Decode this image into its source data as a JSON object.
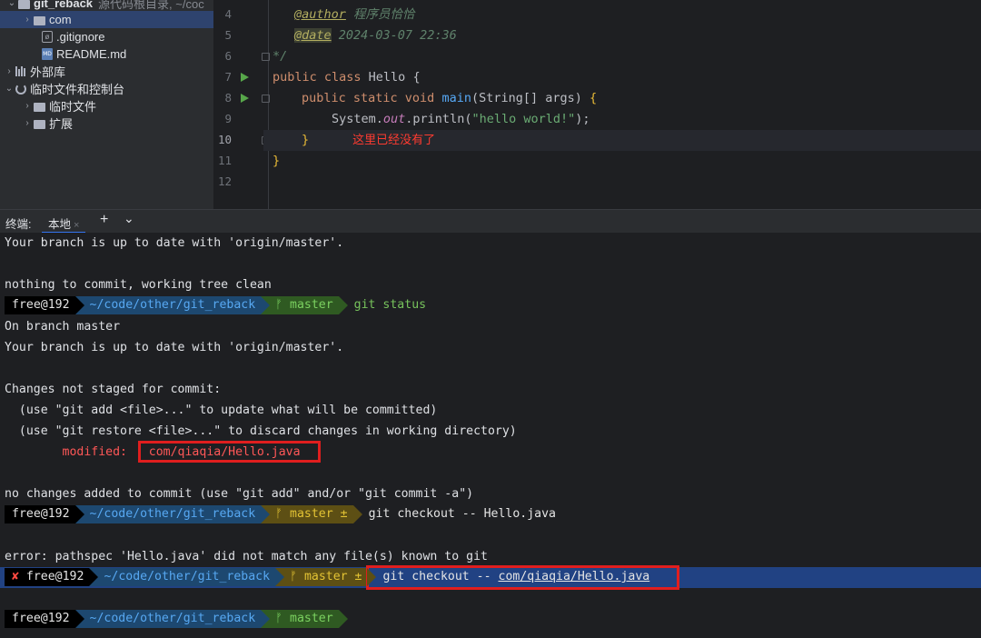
{
  "project_tree": {
    "root": {
      "name": "git_reback",
      "hint": "源代码根目录, ~/coc"
    },
    "items": [
      {
        "label": "com"
      },
      {
        "label": ".gitignore"
      },
      {
        "label": "README.md"
      },
      {
        "label": "外部库"
      },
      {
        "label": "临时文件和控制台"
      },
      {
        "label": "临时文件"
      },
      {
        "label": "扩展"
      }
    ]
  },
  "editor": {
    "line_numbers": [
      "4",
      "5",
      "6",
      "7",
      "8",
      "9",
      "10",
      "11",
      "12"
    ],
    "code": {
      "l4_tag": "@author",
      "l4_text": " 程序员恰恰",
      "l5_tag": "@date",
      "l5_text": " 2024-03-07 22:36",
      "l6": "*/",
      "l7_kw": "public class ",
      "l7_name": "Hello ",
      "l7_brace": "{",
      "l8_kw": "public static void ",
      "l8_fn": "main",
      "l8_args": "(String[] args) ",
      "l8_brace": "{",
      "l9_a": "System.",
      "l9_field": "out",
      "l9_b": ".println(",
      "l9_str": "\"hello world!\"",
      "l9_c": ");",
      "l10_brace": "}",
      "l10_note": "这里已经没有了",
      "l11": "}"
    }
  },
  "terminal_tabs": {
    "label": "终端:",
    "local_tab": "本地",
    "close": "×",
    "add": "+",
    "dropdown": "⌄"
  },
  "terminal": {
    "lines": {
      "l1": "Your branch is up to date with 'origin/master'.",
      "l2": "nothing to commit, working tree clean",
      "l4": "On branch master",
      "l5": "Your branch is up to date with 'origin/master'.",
      "l6": "Changes not staged for commit:",
      "l7": "  (use \"git add <file>...\" to update what will be committed)",
      "l8": "  (use \"git restore <file>...\" to discard changes in working directory)",
      "l9_label": "        modified:   ",
      "l9_file": "com/qiaqia/Hello.java",
      "l10": "no changes added to commit (use \"git add\" and/or \"git commit -a\")",
      "l12": "error: pathspec 'Hello.java' did not match any file(s) known to git"
    },
    "prompt_user": "free@192",
    "prompt_path": "~/code/other/git_reback",
    "branch_icon": "ᚠ",
    "branch_clean": "master",
    "branch_dirty": "master ±",
    "error_mark": "✘",
    "cmd1": "git status",
    "cmd2": "git checkout -- Hello.java",
    "cmd3_prefix": "git checkout -- ",
    "cmd3_path": "com/qiaqia/Hello.java"
  }
}
